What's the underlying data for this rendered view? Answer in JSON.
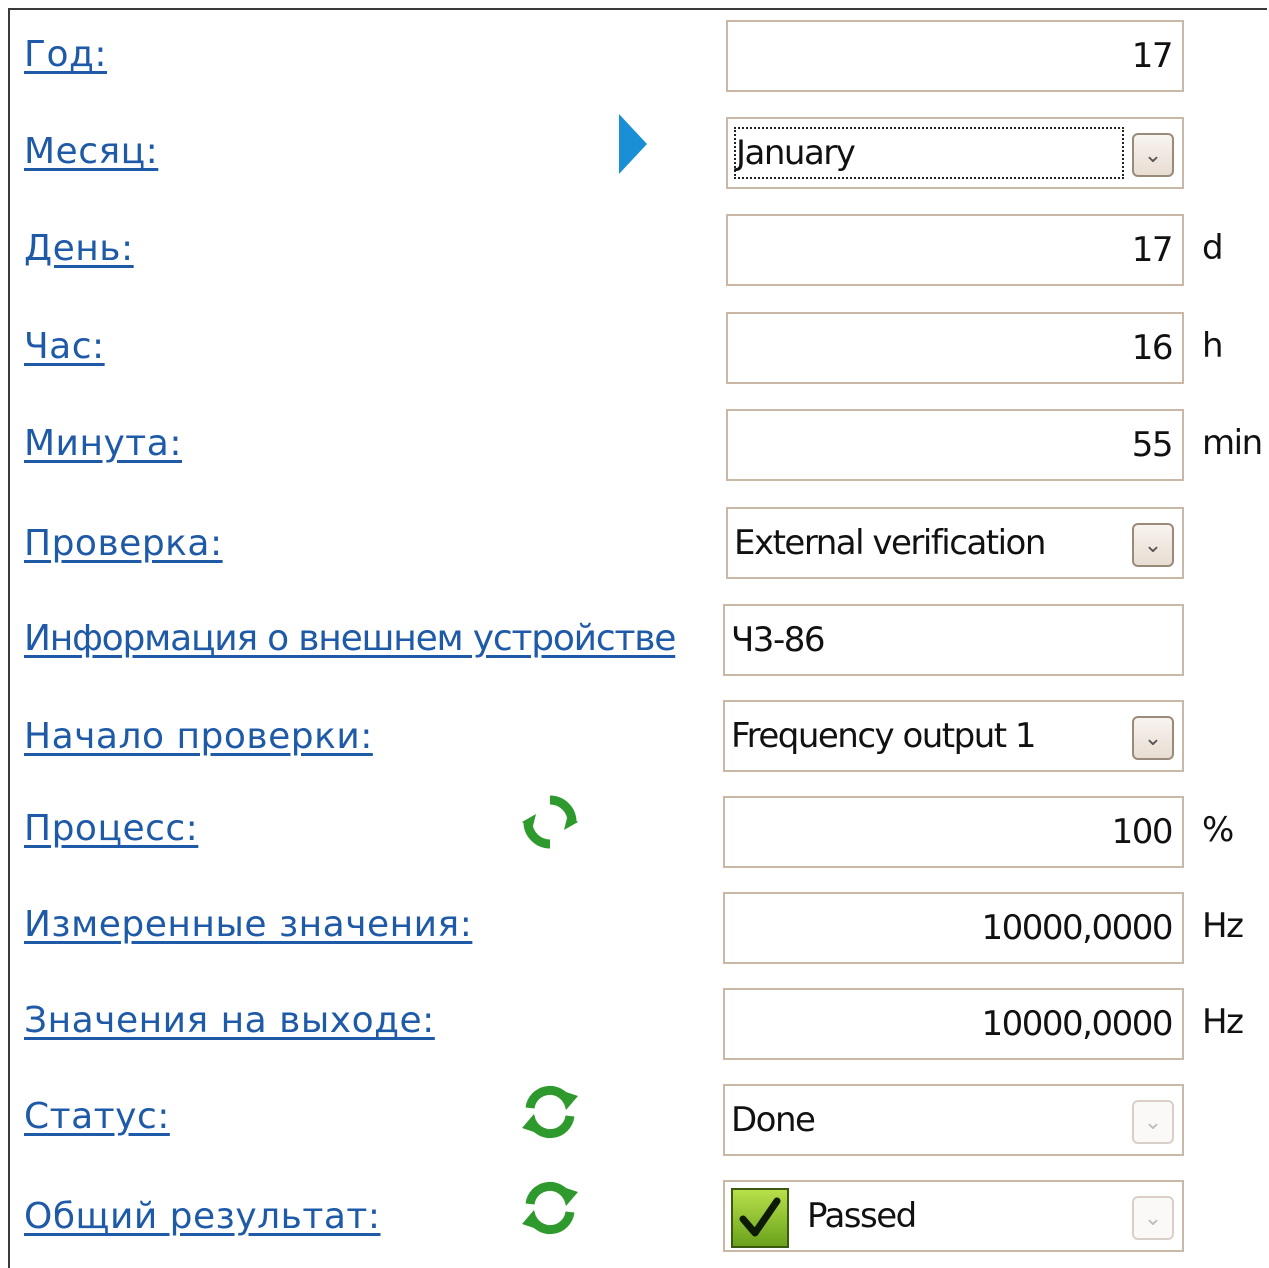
{
  "form": {
    "rows": [
      {
        "label": "Год:",
        "value": "17",
        "unit": ""
      },
      {
        "label": "Месяц:",
        "value": "January",
        "unit": ""
      },
      {
        "label": "День:",
        "value": "17",
        "unit": "d"
      },
      {
        "label": "Час:",
        "value": "16",
        "unit": "h"
      },
      {
        "label": "Минута:",
        "value": "55",
        "unit": "min"
      },
      {
        "label": "Проверка:",
        "value": "External verification",
        "unit": ""
      },
      {
        "label": "Информация о внешнем устройстве",
        "value": "Ч3-86",
        "unit": ""
      },
      {
        "label": "Начало проверки:",
        "value": "Frequency output 1",
        "unit": ""
      },
      {
        "label": "Процесс:",
        "value": "100",
        "unit": "%"
      },
      {
        "label": "Измеренные значения:",
        "value": "10000,0000",
        "unit": "Hz"
      },
      {
        "label": "Значения на выходе:",
        "value": "10000,0000",
        "unit": "Hz"
      },
      {
        "label": "Статус:",
        "value": "Done",
        "unit": ""
      },
      {
        "label": "Общий результат:",
        "value": "Passed",
        "unit": ""
      }
    ]
  },
  "icons": {
    "selected_row_marker": "right-triangle-icon",
    "refresh": "refresh-icon",
    "dropdown": "chevron-down-icon",
    "checkmark": "checkmark-icon"
  },
  "colors": {
    "label": "#1e5aa8",
    "selected_marker": "#1a8fd6",
    "refresh_green": "#2e9a2e",
    "check_green": "#8cc63f",
    "field_border": "#c9b8a6"
  }
}
